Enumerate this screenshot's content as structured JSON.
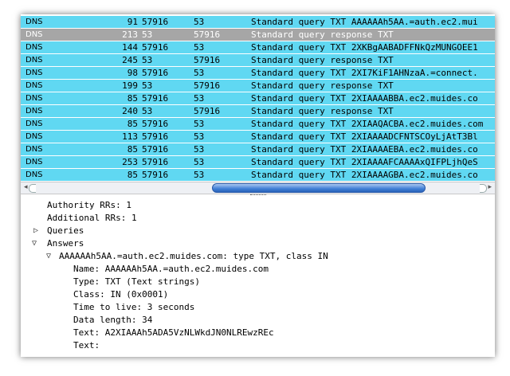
{
  "packets": [
    {
      "proto": "DNS",
      "len": "91",
      "sport": "57916",
      "dport": "53",
      "info": "Standard query TXT AAAAAAh5AA.=auth.ec2.mui",
      "selected": false
    },
    {
      "proto": "DNS",
      "len": "213",
      "sport": "53",
      "dport": "57916",
      "info": "Standard query response TXT",
      "selected": true
    },
    {
      "proto": "DNS",
      "len": "144",
      "sport": "57916",
      "dport": "53",
      "info": "Standard query TXT 2XKBgAABADFFNkQzMUNGOEE1",
      "selected": false
    },
    {
      "proto": "DNS",
      "len": "245",
      "sport": "53",
      "dport": "57916",
      "info": "Standard query response TXT",
      "selected": false
    },
    {
      "proto": "DNS",
      "len": "98",
      "sport": "57916",
      "dport": "53",
      "info": "Standard query TXT 2XI7KiF1AHNzaA.=connect.",
      "selected": false
    },
    {
      "proto": "DNS",
      "len": "199",
      "sport": "53",
      "dport": "57916",
      "info": "Standard query response TXT",
      "selected": false
    },
    {
      "proto": "DNS",
      "len": "85",
      "sport": "57916",
      "dport": "53",
      "info": "Standard query TXT 2XIAAAABBA.ec2.muides.co",
      "selected": false
    },
    {
      "proto": "DNS",
      "len": "240",
      "sport": "53",
      "dport": "57916",
      "info": "Standard query response TXT",
      "selected": false
    },
    {
      "proto": "DNS",
      "len": "85",
      "sport": "57916",
      "dport": "53",
      "info": "Standard query TXT 2XIAAQACBA.ec2.muides.com",
      "selected": false
    },
    {
      "proto": "DNS",
      "len": "113",
      "sport": "57916",
      "dport": "53",
      "info": "Standard query TXT 2XIAAAADCFNTSCOyLjAtT3Bl",
      "selected": false
    },
    {
      "proto": "DNS",
      "len": "85",
      "sport": "57916",
      "dport": "53",
      "info": "Standard query TXT 2XIAAAAEBA.ec2.muides.co",
      "selected": false
    },
    {
      "proto": "DNS",
      "len": "253",
      "sport": "57916",
      "dport": "53",
      "info": "Standard query TXT 2XIAAAAFCAAAAxQIFPLjhQeS",
      "selected": false
    },
    {
      "proto": "DNS",
      "len": "85",
      "sport": "57916",
      "dport": "53",
      "info": "Standard query TXT 2XIAAAAGBA.ec2.muides.co",
      "selected": false
    }
  ],
  "scrollbar": {
    "left_arrow": "◂",
    "right_arrow": "▸"
  },
  "detail": {
    "authority_rrs": "Authority RRs: 1",
    "additional_rrs": "Additional RRs: 1",
    "queries": "Queries",
    "answers": "Answers",
    "answer_record": "AAAAAAh5AA.=auth.ec2.muides.com: type TXT, class IN",
    "name": "Name: AAAAAAh5AA.=auth.ec2.muides.com",
    "type": "Type: TXT (Text strings)",
    "class": "Class: IN (0x0001)",
    "ttl": "Time to live: 3 seconds",
    "data_length": "Data length: 34",
    "text1": "Text: A2XIAAAh5ADA5VzNLWkdJN0NLREwzREc",
    "text2": "Text:",
    "collapsed_glyph": "▷",
    "expanded_glyph": "▽"
  },
  "colors": {
    "row": "#60d8f2",
    "selected_row": "#a6a6a6",
    "thumb": "#3f7ed6"
  }
}
